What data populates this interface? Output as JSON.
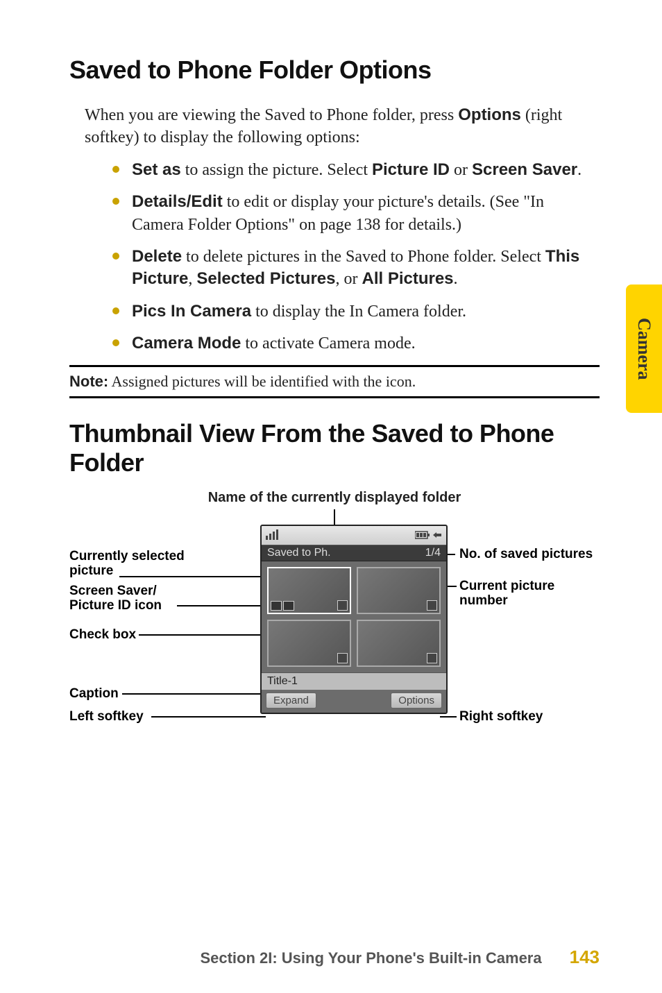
{
  "side_tab": "Camera",
  "heading1": "Saved to Phone Folder Options",
  "intro_parts": {
    "a": "When you are viewing the Saved to Phone folder, press ",
    "b": "Options",
    "c": " (right softkey) to display the following options:"
  },
  "bullets": [
    {
      "b": "Set as",
      "rest": " to assign the picture. Select ",
      "b2": "Picture ID",
      "mid": " or ",
      "b3": "Screen Saver",
      "end": "."
    },
    {
      "b": "Details/Edit",
      "rest": " to edit or display your picture's details. (See \"In Camera Folder Options\" on page 138 for details.)"
    },
    {
      "b": "Delete",
      "rest": " to delete pictures in the Saved to Phone folder. Select ",
      "b2": "This Picture",
      "mid": ", ",
      "b3": "Selected Pictures",
      "mid2": ", or ",
      "b4": "All Pictures",
      "end": "."
    },
    {
      "b": "Pics In Camera",
      "rest": " to display the In Camera folder."
    },
    {
      "b": "Camera Mode",
      "rest": " to activate Camera mode."
    }
  ],
  "note": {
    "label": "Note:",
    "text": " Assigned pictures will be identified with the icon."
  },
  "heading2": "Thumbnail View From the Saved to Phone Folder",
  "diagram": {
    "top_label": "Name of the currently displayed folder",
    "folder_name": "Saved to Ph.",
    "counter": "1/4",
    "caption": "Title-1",
    "left_softkey": "Expand",
    "right_softkey": "Options",
    "left_labels": {
      "sel_pic": "Currently selected picture",
      "ss_icon": "Screen Saver/ Picture ID icon",
      "check": "Check box",
      "caption": "Caption",
      "lsk": "Left softkey"
    },
    "right_labels": {
      "num_saved": "No. of saved pictures",
      "cur_num": "Current picture number",
      "rsk": "Right softkey"
    }
  },
  "footer": {
    "section": "Section 2I: Using Your Phone's Built-in Camera",
    "page": "143"
  }
}
